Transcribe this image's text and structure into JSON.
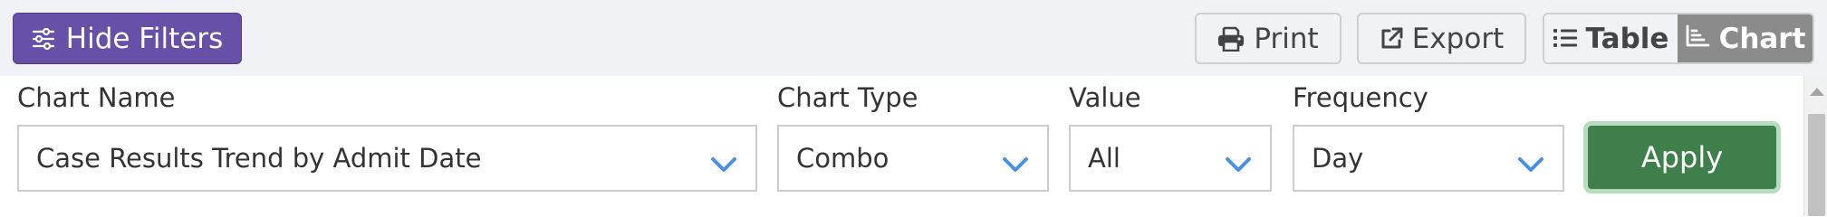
{
  "toolbar": {
    "hide_filters_label": "Hide Filters",
    "print_label": "Print",
    "export_label": "Export",
    "view_toggle": {
      "table_label": "Table",
      "chart_label": "Chart",
      "active": "Chart"
    }
  },
  "filters": {
    "chart_name": {
      "label": "Chart Name",
      "value": "Case Results Trend by Admit Date"
    },
    "chart_type": {
      "label": "Chart Type",
      "value": "Combo"
    },
    "value": {
      "label": "Value",
      "value": "All"
    },
    "frequency": {
      "label": "Frequency",
      "value": "Day"
    },
    "apply_label": "Apply"
  },
  "icons": {
    "hide_filters": "sliders-icon",
    "print": "printer-icon",
    "export": "external-link-icon",
    "table": "list-icon",
    "chart": "chart-area-icon",
    "select": "chevron-down-icon"
  },
  "colors": {
    "primary_purple": "#6650a8",
    "apply_green": "#3f7f4c",
    "chevron_blue": "#4a90e2",
    "toggle_active": "#8b8b8b",
    "topbar_bg": "#f1f2f6"
  }
}
